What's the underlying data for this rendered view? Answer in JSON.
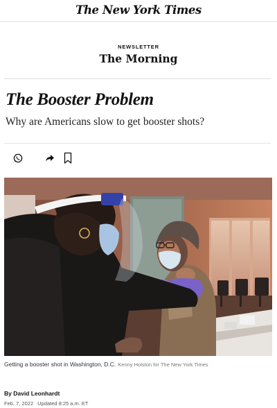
{
  "masthead": {
    "logo_text": "The New York Times"
  },
  "newsletter": {
    "kicker": "NEWSLETTER",
    "title": "The Morning"
  },
  "article": {
    "headline": "The Booster Problem",
    "summary": "Why are Americans slow to get booster shots?",
    "caption": "Getting a booster shot in Washington, D.C.",
    "credit": "Kenny Holston for The New York Times",
    "byline": "By David Leonhardt",
    "date": "Feb. 7, 2022",
    "updated": "Updated 8:25 a.m. ET"
  },
  "share_bar": {
    "icons": [
      "whatsapp-icon",
      "share-icon",
      "bookmark-icon"
    ]
  },
  "colors": {
    "text": "#121212",
    "rule": "#e2e2e2",
    "photo_warm": "#b5704e"
  }
}
